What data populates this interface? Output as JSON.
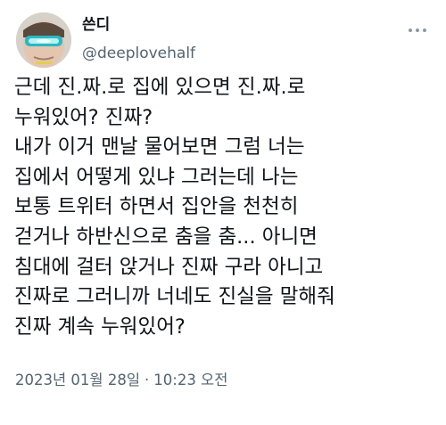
{
  "author": {
    "display_name": "쓴디",
    "handle": "@deeplovehalf",
    "avatar": "avatar-photo"
  },
  "more_icon": "more-horizontal-icon",
  "tweet": {
    "lines": [
      "근데 진.짜.로 집에 있으면 진.짜.로",
      "누워있어? 진짜?",
      "내가 이거 맨날 물어보면 그럼 너는",
      "집에서 어떻게 있냐 그러는데 나는",
      "보통 트위터 하면서 집안을 천천히",
      "걷거나 하반신으로 춤을 춤... 아니면",
      "침대에 걸터 앉거나 진짜 구라 아니고",
      "진짜로 그러니까 너네도 진실을 말해줘",
      "진짜 계속 누워있어?"
    ]
  },
  "meta": {
    "date": "2023년 01월 28일",
    "separator": "·",
    "time": "10:23 오전"
  },
  "colors": {
    "text": "#0f1419",
    "secondary": "#536471",
    "icon": "#8b98a5"
  }
}
